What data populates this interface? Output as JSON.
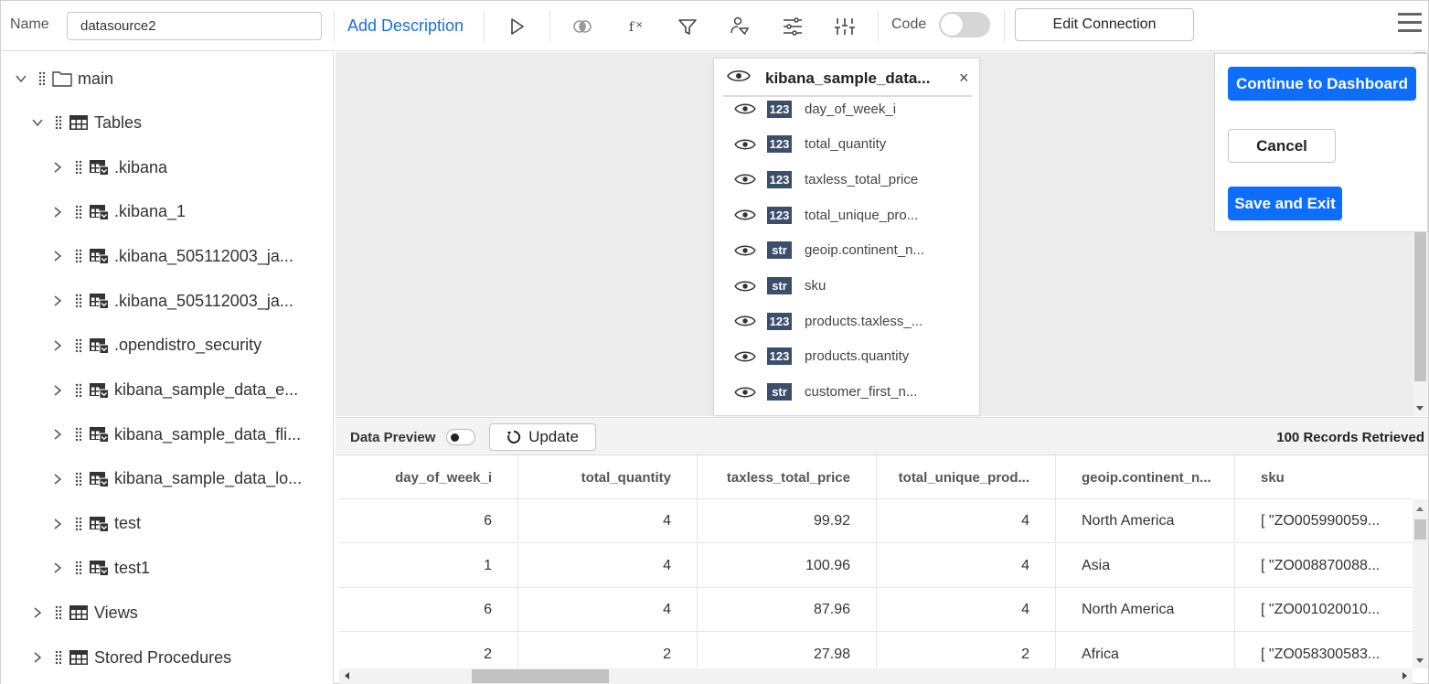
{
  "toolbar": {
    "name_label": "Name",
    "name_value": "datasource2",
    "add_description": "Add Description",
    "code_label": "Code",
    "code_enabled": false,
    "edit_connection": "Edit Connection",
    "icons": [
      "run-icon",
      "join-icon",
      "formula-icon",
      "filter-icon",
      "parameter-filter-icon",
      "settings-sliders-icon",
      "expression-icon"
    ]
  },
  "tree": {
    "root": "main",
    "tables_label": "Tables",
    "tables": [
      ".kibana",
      ".kibana_1",
      ".kibana_505112003_ja...",
      ".kibana_505112003_ja...",
      ".opendistro_security",
      "kibana_sample_data_e...",
      "kibana_sample_data_fli...",
      "kibana_sample_data_lo...",
      "test",
      "test1"
    ],
    "views_label": "Views",
    "procedures_label": "Stored Procedures"
  },
  "table_card": {
    "title": "kibana_sample_data...",
    "fields": [
      {
        "type": "123",
        "name": "day_of_week_i"
      },
      {
        "type": "123",
        "name": "total_quantity"
      },
      {
        "type": "123",
        "name": "taxless_total_price"
      },
      {
        "type": "123",
        "name": "total_unique_pro..."
      },
      {
        "type": "str",
        "name": "geoip.continent_n..."
      },
      {
        "type": "str",
        "name": "sku"
      },
      {
        "type": "123",
        "name": "products.taxless_..."
      },
      {
        "type": "123",
        "name": "products.quantity"
      },
      {
        "type": "str",
        "name": "customer_first_n..."
      }
    ]
  },
  "actions": {
    "continue": "Continue to Dashboard",
    "cancel": "Cancel",
    "save_exit": "Save and Exit",
    "primary_color": "#0d6efd"
  },
  "preview": {
    "label": "Data Preview",
    "enabled": false,
    "update": "Update",
    "records": "100 Records Retrieved",
    "columns": [
      "day_of_week_i",
      "total_quantity",
      "taxless_total_price",
      "total_unique_prod...",
      "geoip.continent_n...",
      "sku"
    ],
    "rows": [
      [
        "6",
        "4",
        "99.92",
        "4",
        "North America",
        "[ \"ZO005990059..."
      ],
      [
        "1",
        "4",
        "100.96",
        "4",
        "Asia",
        "[ \"ZO008870088..."
      ],
      [
        "6",
        "4",
        "87.96",
        "4",
        "North America",
        "[ \"ZO001020010..."
      ],
      [
        "2",
        "2",
        "27.98",
        "2",
        "Africa",
        "[ \"ZO058300583..."
      ]
    ]
  }
}
